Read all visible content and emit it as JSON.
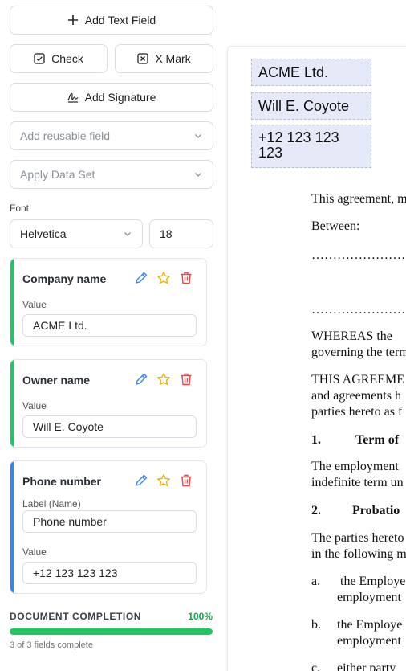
{
  "toolbar": {
    "add_text_field": "Add Text Field",
    "check": "Check",
    "x_mark": "X Mark",
    "add_signature": "Add Signature"
  },
  "selects": {
    "reusable_field_placeholder": "Add reusable field",
    "data_set_placeholder": "Apply Data Set"
  },
  "font": {
    "label": "Font",
    "family": "Helvetica",
    "size": "18"
  },
  "fields": [
    {
      "title": "Company name",
      "value_label": "Value",
      "value": "ACME Ltd.",
      "accent": "#22c55e"
    },
    {
      "title": "Owner name",
      "value_label": "Value",
      "value": "Will E. Coyote",
      "accent": "#22c55e"
    },
    {
      "title": "Phone number",
      "name_label": "Label (Name)",
      "name": "Phone number",
      "value_label": "Value",
      "value": "+12 123 123 123",
      "accent": "#3b82f6"
    }
  ],
  "completion": {
    "label": "DOCUMENT COMPLETION",
    "percent_text": "100%",
    "percent": 100,
    "summary": "3 of 3 fields complete"
  },
  "document": {
    "overlays": [
      "ACME Ltd.",
      "Will E. Coyote",
      "+12 123 123\n123"
    ],
    "lines": [
      "This agreement, m",
      "Between:",
      "……………………",
      "……………………",
      "WHEREAS the",
      "governing the term",
      "THIS AGREEME",
      "and agreements h",
      "parties hereto as f",
      "1.",
      "Term of",
      "The employment",
      "indefinite term un",
      "2.",
      "Probatio",
      "The parties hereto",
      "in the following m",
      "a.",
      "the Employe",
      "employment",
      "b.",
      "the Employe",
      "employment",
      "c.",
      "either party"
    ]
  },
  "colors": {
    "edit_icon": "#3b82f6",
    "star_icon": "#eab308",
    "trash_icon": "#ef4444",
    "progress": "#22c55e"
  }
}
